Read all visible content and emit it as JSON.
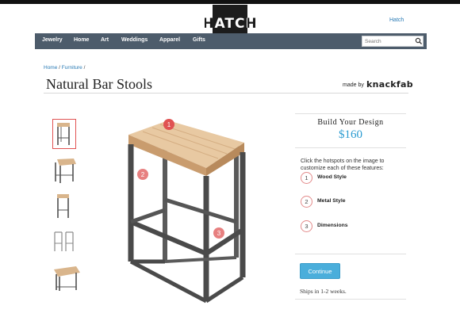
{
  "site": {
    "logo_text": "HATCH",
    "top_link": "Hatch"
  },
  "nav": {
    "items": [
      "Jewelry",
      "Home",
      "Art",
      "Weddings",
      "Apparel",
      "Gifts"
    ],
    "search_placeholder": "Search"
  },
  "breadcrumb": {
    "home": "Home",
    "sep1": " / ",
    "furniture": "Furniture",
    "sep2": " /"
  },
  "product": {
    "title": "Natural Bar Stools",
    "made_by_label": "made by",
    "maker": "knackfab",
    "thumbnail_count": 5,
    "selected_thumbnail": 1,
    "hotspots": [
      "1",
      "2",
      "3"
    ]
  },
  "design_panel": {
    "title": "Build Your Design",
    "price": "$160",
    "instructions": "Click the hotspots on the image to customize each of these features:",
    "features": [
      {
        "num": "1",
        "label": "Wood Style"
      },
      {
        "num": "2",
        "label": "Metal Style"
      },
      {
        "num": "3",
        "label": "Dimensions"
      }
    ],
    "continue_label": "Continue",
    "shipping": "Ships in 1-2 weeks."
  },
  "colors": {
    "nav_bg": "#4d5c6b",
    "accent_blue": "#2a9bd1",
    "button_blue": "#4aaedb",
    "hotspot_red": "#e05252",
    "link_blue": "#2a7bb5"
  }
}
